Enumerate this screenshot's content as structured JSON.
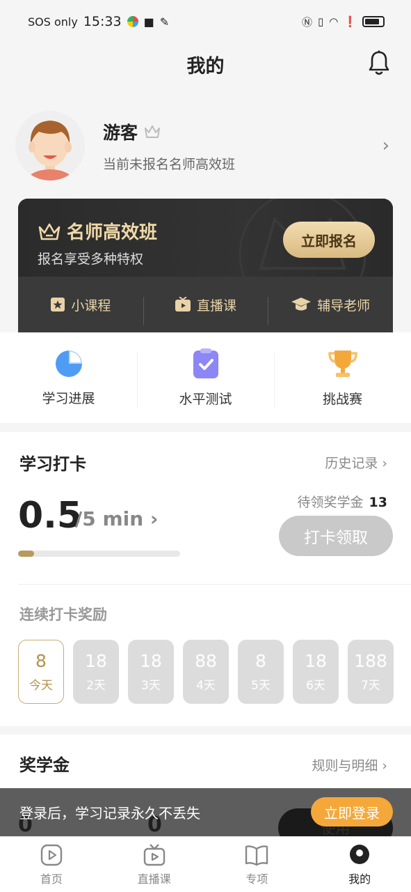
{
  "statusbar": {
    "carrier": "SOS only",
    "time": "15:33"
  },
  "header": {
    "title": "我的"
  },
  "profile": {
    "name": "游客",
    "subtitle": "当前未报名名师高效班"
  },
  "vip": {
    "title": "名师高效班",
    "subtitle": "报名享受多种特权",
    "button": "立即报名",
    "features": [
      "小课程",
      "直播课",
      "辅导老师"
    ]
  },
  "tools": [
    {
      "label": "学习进展",
      "icon": "pie-chart-icon"
    },
    {
      "label": "水平测试",
      "icon": "clipboard-check-icon"
    },
    {
      "label": "挑战赛",
      "icon": "trophy-icon"
    }
  ],
  "checkin": {
    "title": "学习打卡",
    "history": "历史记录",
    "current": "0.5",
    "goal": "/5 min",
    "progress": 0.1,
    "pending_label": "待领奖学金",
    "pending_value": "13",
    "claim_button": "打卡领取",
    "streak_title": "连续打卡奖励",
    "days": [
      {
        "value": "8",
        "label": "今天"
      },
      {
        "value": "18",
        "label": "2天"
      },
      {
        "value": "18",
        "label": "3天"
      },
      {
        "value": "88",
        "label": "4天"
      },
      {
        "value": "8",
        "label": "5天"
      },
      {
        "value": "18",
        "label": "6天"
      },
      {
        "value": "188",
        "label": "7天"
      }
    ]
  },
  "scholarship": {
    "title": "奖学金",
    "rules": "规则与明细",
    "value1": "0",
    "value2": "0",
    "use_button": "使用"
  },
  "login_banner": {
    "text": "登录后，学习记录永久不丢失",
    "button": "立即登录"
  },
  "tabbar": [
    {
      "label": "首页",
      "icon": "play-circle-icon"
    },
    {
      "label": "直播课",
      "icon": "tv-icon"
    },
    {
      "label": "专项",
      "icon": "book-icon"
    },
    {
      "label": "我的",
      "icon": "profile-icon"
    }
  ]
}
